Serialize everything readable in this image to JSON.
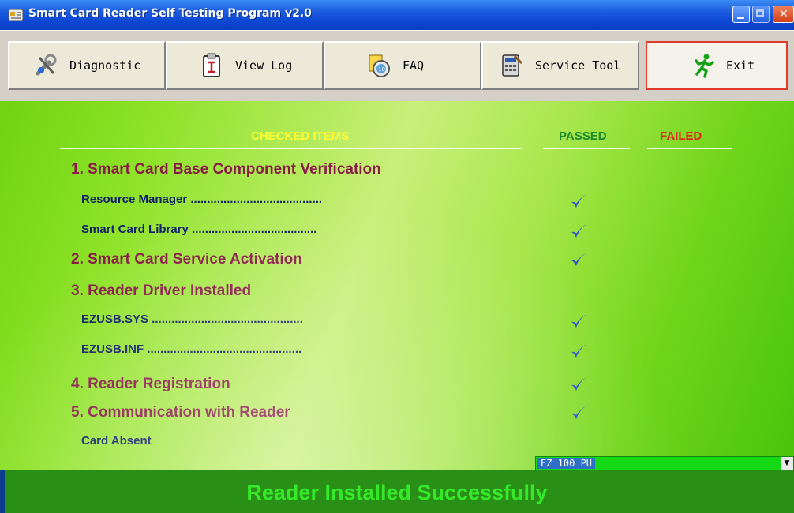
{
  "window": {
    "title": "Smart Card Reader Self Testing Program v2.0"
  },
  "toolbar": {
    "diagnostic_label": "Diagnostic",
    "view_log_label": "View Log",
    "faq_label": "FAQ",
    "service_tool_label": "Service Tool",
    "exit_label": "Exit"
  },
  "table": {
    "col_checked": "CHECKED ITEMS",
    "col_passed": "PASSED",
    "col_failed": "FAILED",
    "colors": {
      "checked": "#ffff33",
      "passed": "#1a8a2a",
      "failed": "#e8231a"
    },
    "rows": [
      {
        "text": "1. Smart Card Base Component Verification",
        "kind": "section",
        "passed": false
      },
      {
        "text": "Resource Manager ........................................",
        "kind": "item",
        "passed": true
      },
      {
        "text": "Smart Card Library ......................................",
        "kind": "item",
        "passed": true
      },
      {
        "text": "2. Smart Card Service Activation",
        "kind": "section",
        "passed": true
      },
      {
        "text": "3. Reader Driver Installed",
        "kind": "section",
        "passed": false
      },
      {
        "text": "EZUSB.SYS ..............................................",
        "kind": "item",
        "passed": true
      },
      {
        "text": "EZUSB.INF ...............................................",
        "kind": "item",
        "passed": true
      },
      {
        "text": "4. Reader Registration",
        "kind": "section",
        "passed": true
      },
      {
        "text": "5. Communication with Reader",
        "kind": "section",
        "passed": true
      },
      {
        "text": "Card Absent",
        "kind": "item",
        "passed": false
      }
    ]
  },
  "reader_select": {
    "value": "EZ 100 PU"
  },
  "status": {
    "message": "Reader Installed Successfully"
  }
}
